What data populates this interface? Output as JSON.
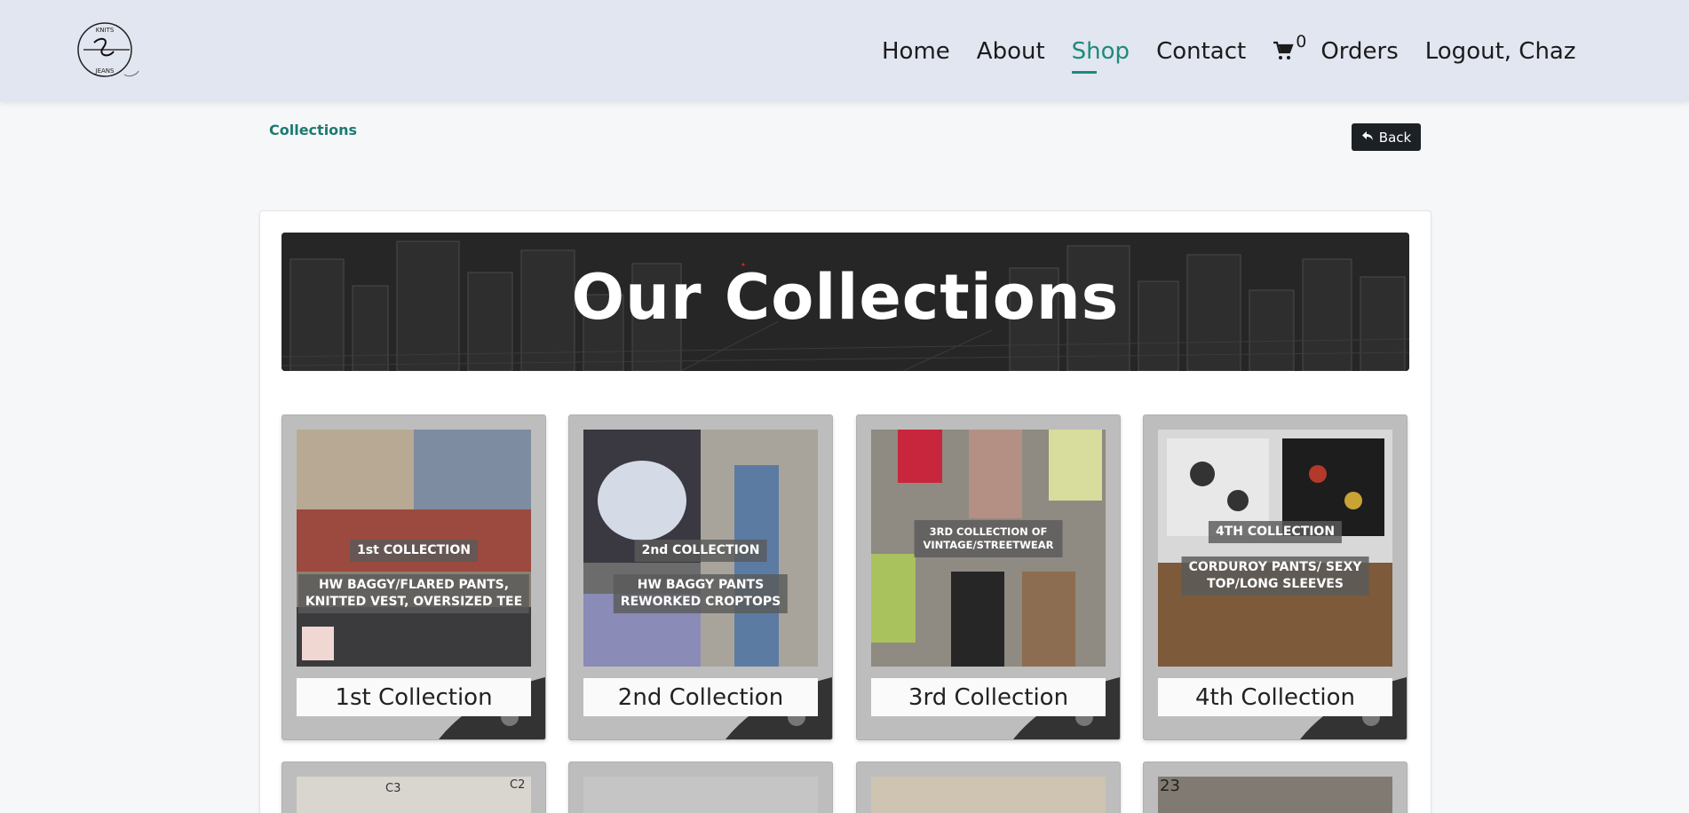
{
  "header": {
    "logo_icon": "knits-and-jeans-logo",
    "nav": [
      {
        "label": "Home",
        "active": false
      },
      {
        "label": "About",
        "active": false
      },
      {
        "label": "Shop",
        "active": true
      },
      {
        "label": "Contact",
        "active": false
      }
    ],
    "cart_icon": "shopping-cart-icon",
    "cart_count": "0",
    "orders_label": "Orders",
    "logout_label": "Logout, Chaz",
    "accent_color": "#1e8a7c"
  },
  "breadcrumb": {
    "label": "Collections"
  },
  "back_button": {
    "label": "Back",
    "icon": "reply-arrow-icon"
  },
  "banner": {
    "title": "Our Collections"
  },
  "collections": [
    {
      "caption": "1st Collection",
      "labels": [
        "1st COLLECTION",
        "HW BAGGY/FLARED PANTS,",
        "KNITTED VEST, OVERSIZED TEE"
      ]
    },
    {
      "caption": "2nd Collection",
      "labels": [
        "2nd COLLECTION",
        "HW BAGGY PANTS",
        "REWORKED CROPTOPS"
      ]
    },
    {
      "caption": "3rd Collection",
      "labels": [
        "3RD COLLECTION OF",
        "VINTAGE/STREETWEAR"
      ]
    },
    {
      "caption": "4th Collection",
      "labels": [
        "4TH COLLECTION",
        "CORDUROY PANTS/ SEXY",
        "TOP/LONG SLEEVES"
      ]
    }
  ],
  "second_row_photo_labels": [
    "C3",
    "C2",
    "23"
  ]
}
